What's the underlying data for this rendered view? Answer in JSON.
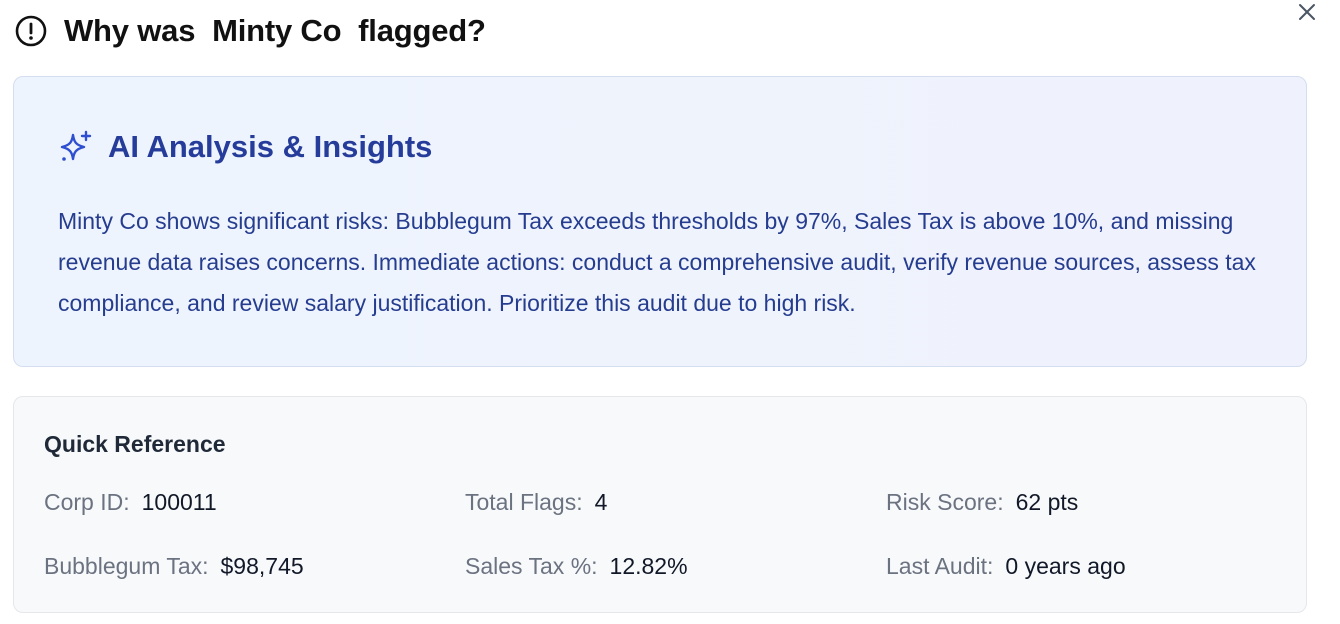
{
  "header": {
    "icon": "alert-circle-icon",
    "title": "Why was  Minty Co  flagged?",
    "close_icon": "close-icon"
  },
  "ai_analysis": {
    "icon": "sparkle-icon",
    "title": "AI Analysis & Insights",
    "body": "Minty Co shows significant risks: Bubblegum Tax exceeds thresholds by 97%, Sales Tax is above 10%, and missing revenue data raises concerns. Immediate actions: conduct a comprehensive audit, verify revenue sources, assess tax compliance, and review salary justification. Prioritize this audit due to high risk.",
    "accent": "#253c9a"
  },
  "quick_reference": {
    "title": "Quick Reference",
    "items": [
      {
        "label": "Corp ID:",
        "value": "100011"
      },
      {
        "label": "Total Flags:",
        "value": "4"
      },
      {
        "label": "Risk Score:",
        "value": "62 pts"
      },
      {
        "label": "Bubblegum Tax:",
        "value": "$98,745"
      },
      {
        "label": "Sales Tax %:",
        "value": "12.82%"
      },
      {
        "label": "Last Audit:",
        "value": "0 years ago"
      }
    ]
  }
}
